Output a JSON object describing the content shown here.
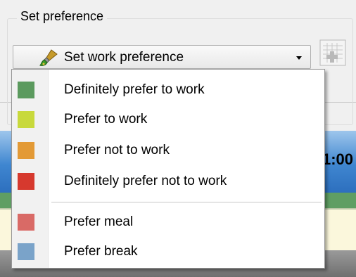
{
  "group": {
    "title": "Set preference"
  },
  "combo": {
    "label": "Set work preference",
    "icon": "paintbrush-icon"
  },
  "grid_button": {
    "icon": "grid-add-icon"
  },
  "background": {
    "time_fragment": "1:00"
  },
  "menu": {
    "items": [
      {
        "label": "Definitely prefer to work",
        "color": "#5b9a5e"
      },
      {
        "label": "Prefer to work",
        "color": "#c8d93c"
      },
      {
        "label": "Prefer not to work",
        "color": "#e39a36"
      },
      {
        "label": "Definitely prefer not to work",
        "color": "#d6392e"
      },
      {
        "label": "Prefer meal",
        "color": "#d96a66"
      },
      {
        "label": "Prefer break",
        "color": "#7aa3c9"
      }
    ]
  }
}
